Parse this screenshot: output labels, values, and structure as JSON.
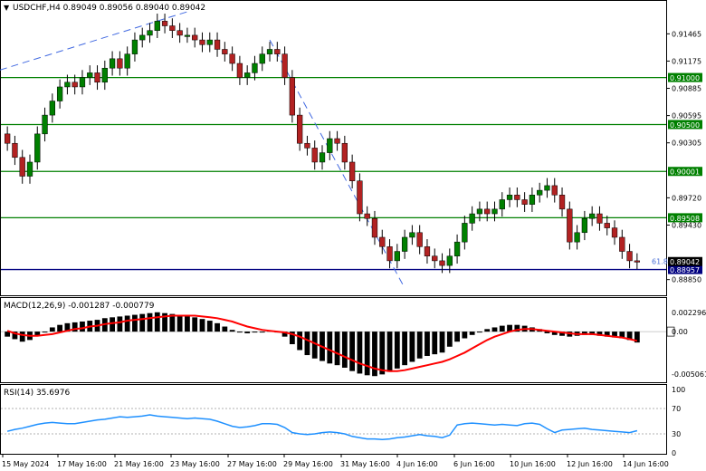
{
  "header": {
    "symbol_line": "USDCHF,H4  0.89049 0.89056 0.89040 0.89042",
    "macd_label": "MACD(12,26,9) -0.001287 -0.000779",
    "rsi_label": "RSI(14) 35.6976"
  },
  "price_axis": {
    "ticks": [
      "0.91465",
      "0.91175",
      "0.90885",
      "0.90595",
      "0.90305",
      "0.89720",
      "0.89430",
      "0.88850"
    ],
    "ylim": [
      0.8876,
      0.9169
    ]
  },
  "macd_axis": {
    "ticks": [
      "0.002296",
      "0.00",
      "-0.005061"
    ],
    "ylim": [
      -0.0056,
      0.0026
    ]
  },
  "rsi_axis": {
    "ticks": [
      "100",
      "70",
      "30",
      "0"
    ],
    "levels": [
      70,
      30
    ]
  },
  "x_axis": {
    "labels": [
      "15 May 2024",
      "17 May 16:00",
      "21 May 16:00",
      "23 May 16:00",
      "27 May 16:00",
      "29 May 16:00",
      "31 May 16:00",
      "4 Jun 16:00",
      "6 Jun 16:00",
      "10 Jun 16:00",
      "12 Jun 16:00",
      "14 Jun 16:00"
    ]
  },
  "levels": [
    {
      "value": 0.91,
      "label": "0.91000",
      "color": "#008000"
    },
    {
      "value": 0.905,
      "label": "0.90500",
      "color": "#008000"
    },
    {
      "value": 0.90001,
      "label": "0.90001",
      "color": "#008000"
    },
    {
      "value": 0.89508,
      "label": "0.89508",
      "color": "#008000"
    },
    {
      "value": 0.88957,
      "label": "0.88957",
      "color": "#000080"
    },
    {
      "value": 0.89042,
      "label": "0.89042",
      "color": "#000000"
    }
  ],
  "fib_label": "61.8",
  "colors": {
    "bull": "#008000",
    "bear": "#b22222",
    "trend": "#4169e1",
    "macd_signal": "#ff0000",
    "rsi": "#1e90ff",
    "level_line": "#008000",
    "current_line": "#000080"
  },
  "chart_data": {
    "type": "candlestick",
    "symbol": "USDCHF",
    "timeframe": "H4",
    "closes": [
      0.903,
      0.9015,
      0.8995,
      0.901,
      0.904,
      0.906,
      0.9075,
      0.909,
      0.9095,
      0.909,
      0.91,
      0.9105,
      0.9095,
      0.911,
      0.912,
      0.911,
      0.9125,
      0.914,
      0.9145,
      0.915,
      0.916,
      0.9155,
      0.915,
      0.9145,
      0.9145,
      0.914,
      0.9135,
      0.914,
      0.913,
      0.9125,
      0.9115,
      0.91,
      0.9105,
      0.9115,
      0.9125,
      0.913,
      0.9125,
      0.91,
      0.906,
      0.903,
      0.9025,
      0.901,
      0.902,
      0.9035,
      0.903,
      0.901,
      0.899,
      0.8955,
      0.895,
      0.893,
      0.892,
      0.8905,
      0.8915,
      0.893,
      0.8935,
      0.892,
      0.891,
      0.8905,
      0.89,
      0.891,
      0.8925,
      0.8945,
      0.8955,
      0.896,
      0.8955,
      0.896,
      0.897,
      0.8975,
      0.897,
      0.8965,
      0.8975,
      0.898,
      0.8985,
      0.8975,
      0.896,
      0.8925,
      0.8935,
      0.895,
      0.8955,
      0.8945,
      0.894,
      0.893,
      0.8915,
      0.8905,
      0.8904
    ],
    "macd": {
      "histogram": [
        -0.0006,
        -0.0009,
        -0.0012,
        -0.001,
        -0.0005,
        0.0,
        0.0005,
        0.0008,
        0.001,
        0.0011,
        0.0012,
        0.0013,
        0.0014,
        0.0016,
        0.0017,
        0.0018,
        0.0019,
        0.002,
        0.0021,
        0.0022,
        0.0023,
        0.0022,
        0.0021,
        0.002,
        0.0019,
        0.0017,
        0.0015,
        0.0013,
        0.001,
        0.0006,
        0.0002,
        -0.0001,
        -0.0002,
        -0.0001,
        0.0,
        0.0001,
        0.0,
        -0.0006,
        -0.0015,
        -0.0022,
        -0.0028,
        -0.0032,
        -0.0035,
        -0.0038,
        -0.004,
        -0.0043,
        -0.0047,
        -0.005,
        -0.0052,
        -0.0053,
        -0.0051,
        -0.0048,
        -0.0044,
        -0.004,
        -0.0036,
        -0.0032,
        -0.0029,
        -0.0027,
        -0.0025,
        -0.0018,
        -0.0012,
        -0.0008,
        -0.0004,
        0.0,
        0.0003,
        0.0005,
        0.0007,
        0.0008,
        0.0008,
        0.0007,
        0.0005,
        0.0003,
        -0.0002,
        -0.0004,
        -0.0005,
        -0.0006,
        -0.0005,
        -0.0004,
        -0.0004,
        -0.0005,
        -0.0006,
        -0.0007,
        -0.0008,
        -0.001,
        -0.0013
      ],
      "signal": [
        0.0001,
        -0.0002,
        -0.0004,
        -0.0005,
        -0.0005,
        -0.0004,
        -0.0003,
        -0.0001,
        0.0001,
        0.0003,
        0.0004,
        0.0006,
        0.0007,
        0.0009,
        0.001,
        0.0011,
        0.0013,
        0.0014,
        0.0015,
        0.0016,
        0.0017,
        0.0018,
        0.0019,
        0.0019,
        0.0019,
        0.0019,
        0.0018,
        0.0017,
        0.0016,
        0.0014,
        0.0012,
        0.0009,
        0.0006,
        0.0004,
        0.0002,
        0.0001,
        0.0,
        -0.0001,
        -0.0003,
        -0.0006,
        -0.001,
        -0.0014,
        -0.0018,
        -0.0022,
        -0.0026,
        -0.003,
        -0.0034,
        -0.0038,
        -0.0041,
        -0.0044,
        -0.0046,
        -0.0047,
        -0.0047,
        -0.0046,
        -0.0044,
        -0.0042,
        -0.004,
        -0.0038,
        -0.0036,
        -0.0033,
        -0.0029,
        -0.0025,
        -0.002,
        -0.0015,
        -0.001,
        -0.0006,
        -0.0003,
        0.0,
        0.0002,
        0.0003,
        0.0003,
        0.0002,
        0.0001,
        0.0,
        -0.0001,
        -0.0002,
        -0.0003,
        -0.0003,
        -0.0003,
        -0.0004,
        -0.0005,
        -0.0006,
        -0.0007,
        -0.0009,
        -0.0011
      ]
    },
    "rsi": [
      34,
      37,
      39,
      42,
      45,
      47,
      48,
      47,
      46,
      46,
      48,
      50,
      52,
      53,
      55,
      57,
      56,
      57,
      58,
      60,
      58,
      57,
      56,
      55,
      54,
      55,
      54,
      53,
      50,
      46,
      42,
      40,
      41,
      43,
      46,
      46,
      45,
      40,
      32,
      30,
      29,
      30,
      32,
      33,
      32,
      30,
      26,
      24,
      22,
      22,
      21,
      22,
      24,
      25,
      27,
      29,
      27,
      26,
      24,
      28,
      44,
      46,
      47,
      46,
      45,
      44,
      45,
      44,
      43,
      46,
      47,
      45,
      38,
      32,
      36,
      37,
      38,
      39,
      37,
      36,
      35,
      34,
      33,
      32,
      35
    ]
  }
}
